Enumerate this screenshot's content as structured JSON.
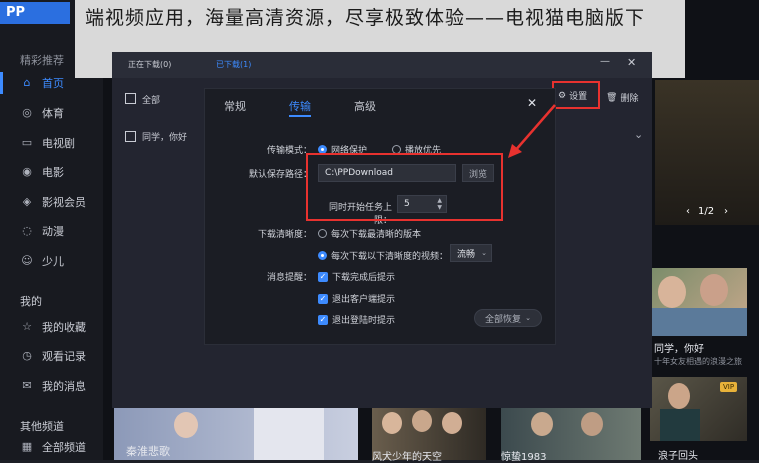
{
  "banner": {
    "text": "端视频应用，海量高清资源，尽享极致体验——电视猫电脑版下"
  },
  "sidebar": {
    "top_label": "精彩推荐",
    "items": [
      {
        "label": "首页",
        "icon": "home-icon",
        "glyph": "⌂"
      },
      {
        "label": "体育",
        "icon": "sports-icon",
        "glyph": "◎"
      },
      {
        "label": "电视剧",
        "icon": "tv-icon",
        "glyph": "▭"
      },
      {
        "label": "电影",
        "icon": "movie-icon",
        "glyph": "◉"
      },
      {
        "label": "影视会员",
        "icon": "vip-icon",
        "glyph": "◈"
      },
      {
        "label": "动漫",
        "icon": "anime-icon",
        "glyph": "◌"
      },
      {
        "label": "少儿",
        "icon": "kids-icon",
        "glyph": "☺"
      }
    ],
    "my_section": "我的",
    "my_items": [
      {
        "label": "我的收藏",
        "icon": "star-icon",
        "glyph": "☆"
      },
      {
        "label": "观看记录",
        "icon": "history-icon",
        "glyph": "◷"
      },
      {
        "label": "我的消息",
        "icon": "message-icon",
        "glyph": "✉"
      }
    ],
    "other_section": "其他频道",
    "other_items": [
      {
        "label": "全部频道",
        "icon": "grid-icon",
        "glyph": "▦"
      }
    ]
  },
  "download_window": {
    "tabs": [
      "正在下载(0)",
      "已下载(1)"
    ],
    "select_all": "全部",
    "list_item": "同学，你好",
    "settings_button": "设置",
    "delete_button": "删除",
    "close_glyph": "✕",
    "minimize_glyph": "—"
  },
  "settings_dialog": {
    "tabs": [
      "常规",
      "传输",
      "高级"
    ],
    "active_tab": "传输",
    "close_glyph": "✕",
    "transfer_mode_label": "传输模式：",
    "transfer_mode_options": [
      "网络保护",
      "播放优先"
    ],
    "save_path_label": "默认保存路径：",
    "save_path_value": "C:\\PPDownload",
    "browse_button": "浏览",
    "max_tasks_label": "同时开始任务上限：",
    "max_tasks_value": "5",
    "clarity_label": "下载清晰度：",
    "clarity_options": [
      "每次下载最清晰的版本",
      "每次下载以下清晰度的视频："
    ],
    "clarity_select": "流畅",
    "notify_label": "消息提醒：",
    "notify_options": [
      "下载完成后提示",
      "退出客户端提示",
      "退出登陆时提示"
    ],
    "restore_button": "全部恢复"
  },
  "content": {
    "pager": "1/2",
    "cards": [
      {
        "title": "同学，你好",
        "subtitle": "十年女友相遇的浪漫之旅"
      },
      {
        "title": "秦淮悲歌",
        "subtitle": ""
      },
      {
        "title": "风犬少年的天空",
        "subtitle": ""
      },
      {
        "title": "惊蛰1983",
        "subtitle": ""
      },
      {
        "title": "浪子回头",
        "subtitle": ""
      }
    ],
    "vip_badge": "VIP"
  },
  "colors": {
    "accent": "#3d8bff",
    "highlight": "#e8322f"
  }
}
